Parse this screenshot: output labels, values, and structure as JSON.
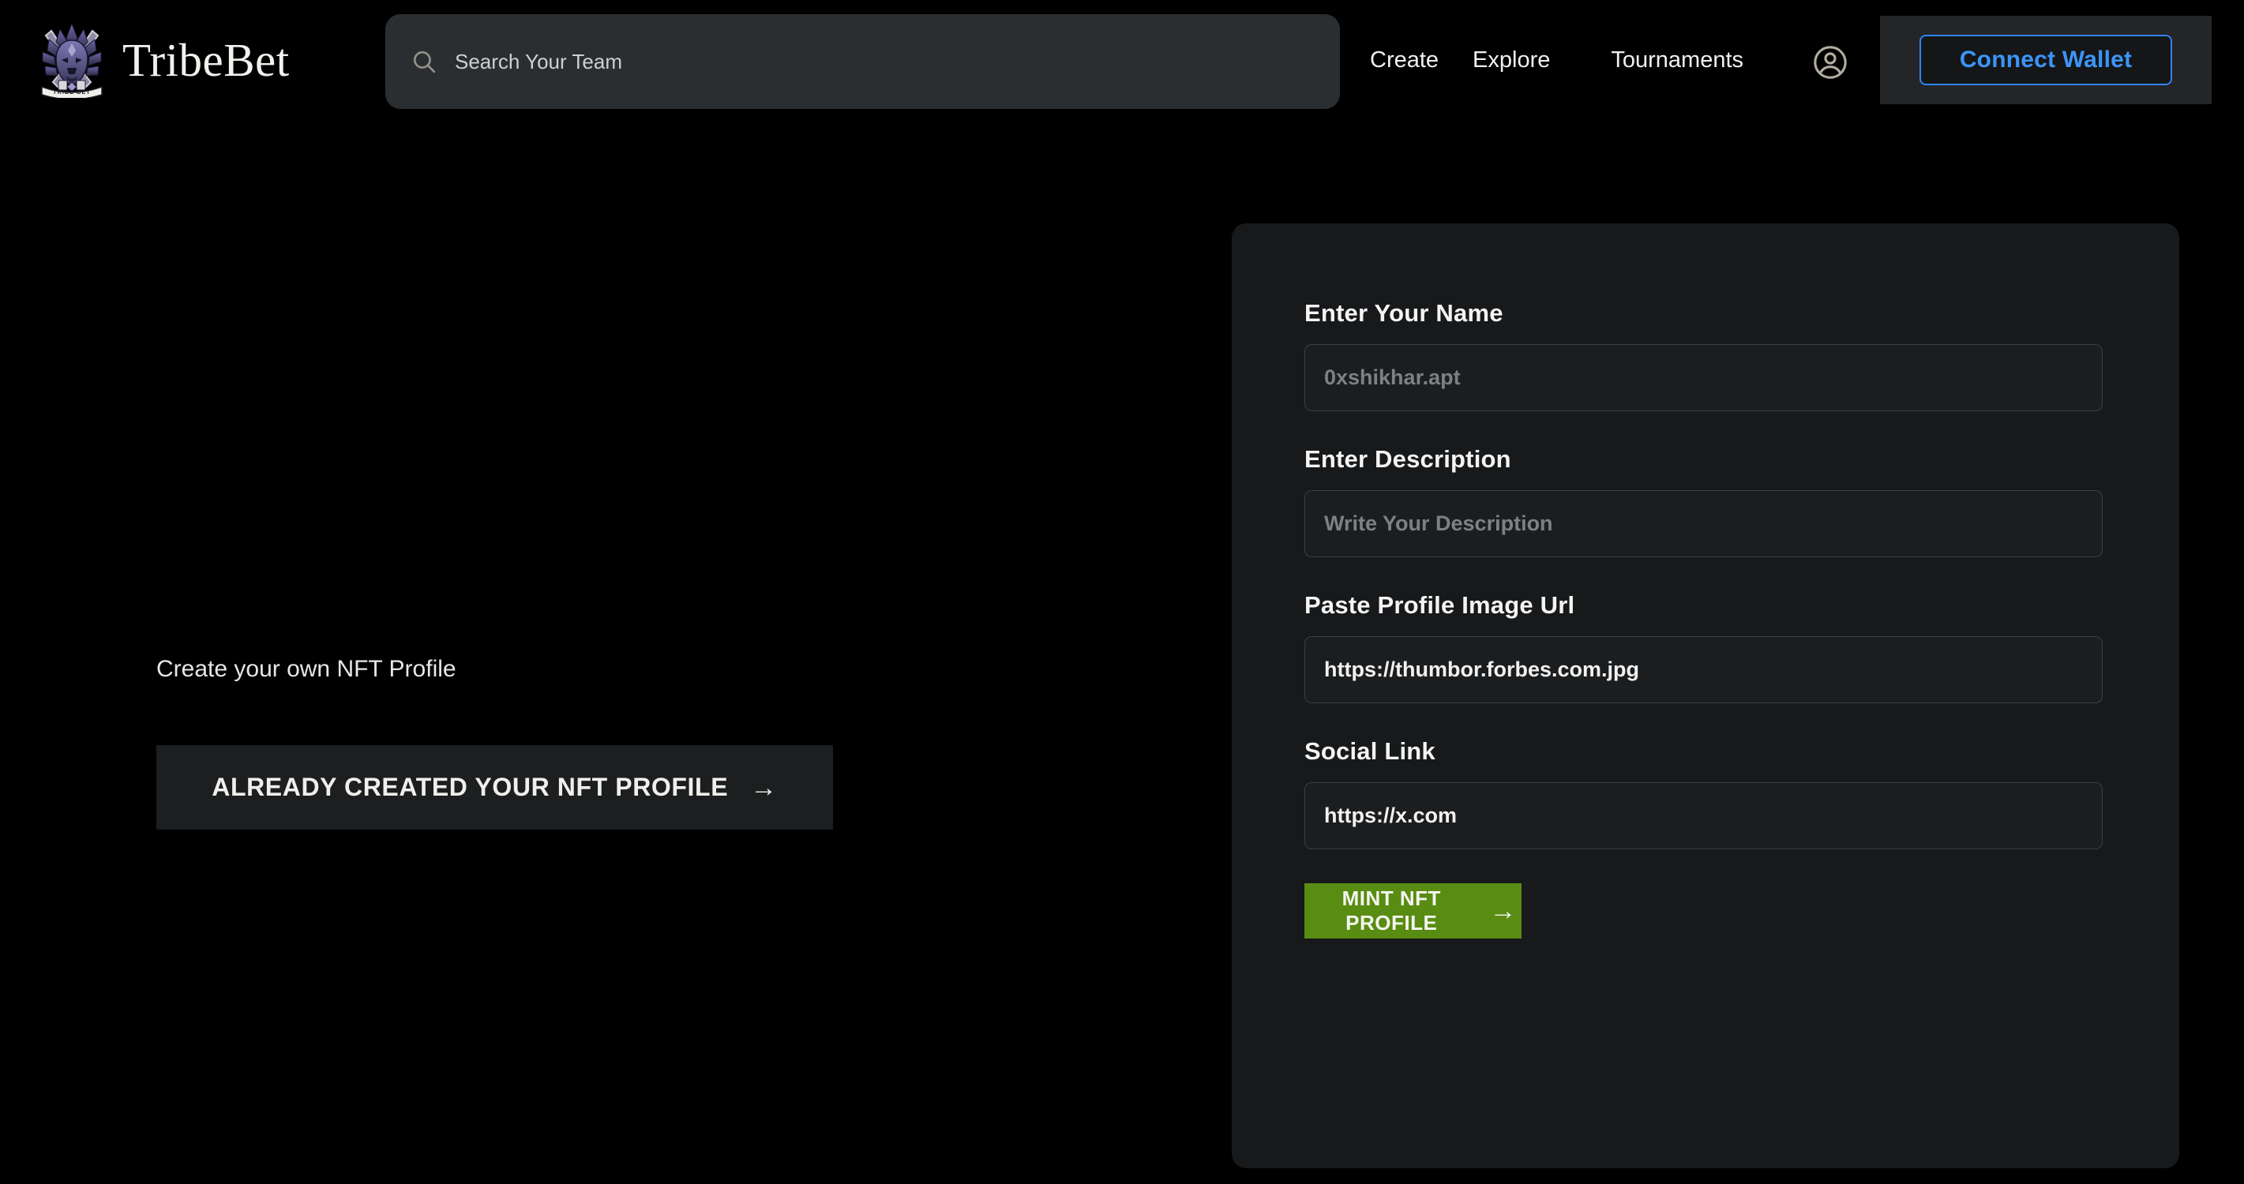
{
  "brand": {
    "name": "TribeBet",
    "logo_icon": "tribal-mask-emblem",
    "logo_banner_text": "TRIBE BET"
  },
  "search": {
    "icon": "search-icon",
    "placeholder": "Search Your Team",
    "value": ""
  },
  "nav": {
    "links": [
      {
        "label": "Create"
      },
      {
        "label": "Explore"
      },
      {
        "label": "Tournaments"
      }
    ],
    "account_icon": "account-circle-icon",
    "wallet_button_label": "Connect Wallet",
    "wallet_accent_color": "#3c95f7"
  },
  "left": {
    "tagline": "Create your own NFT Profile",
    "secondary_button_label": "ALREADY CREATED YOUR NFT PROFILE",
    "secondary_button_icon": "arrow-right-icon"
  },
  "form": {
    "fields": [
      {
        "label": "Enter Your Name",
        "placeholder": "0xshikhar.apt",
        "value": ""
      },
      {
        "label": "Enter Description",
        "placeholder": "Write Your Description",
        "value": ""
      },
      {
        "label": "Paste Profile Image Url",
        "placeholder": "",
        "value": "https://thumbor.forbes.com.jpg"
      },
      {
        "label": "Social Link",
        "placeholder": "",
        "value": "https://x.com"
      }
    ],
    "submit_label": "MINT NFT PROFILE",
    "submit_icon": "arrow-right-icon",
    "submit_color": "#598c12"
  },
  "theme": {
    "page_background": "#000000",
    "panel_background": "#17191b",
    "search_background": "#2b2e30"
  }
}
